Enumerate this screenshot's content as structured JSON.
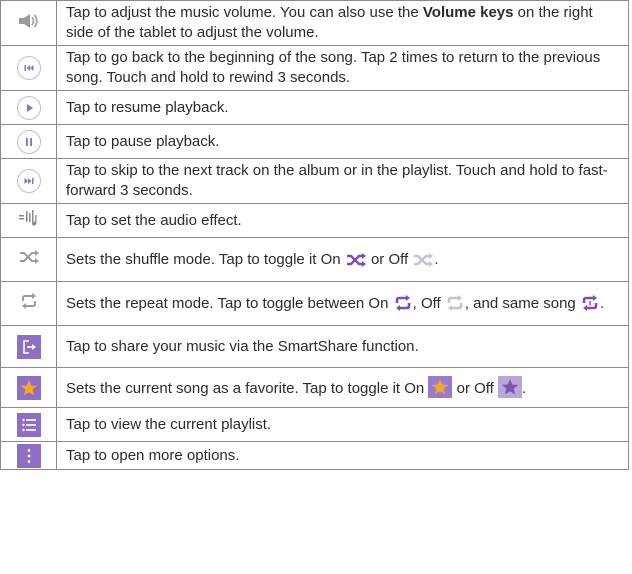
{
  "rows": [
    {
      "icon": "volume-icon",
      "text_pre": "Tap to adjust the music volume. You can also use the ",
      "text_bold": "Volume keys",
      "text_post": " on the right side of the tablet to adjust the volume."
    },
    {
      "icon": "rewind-icon",
      "text": "Tap to go back to the beginning of the song. Tap 2 times to return to the previous song. Touch and hold to rewind 3 seconds."
    },
    {
      "icon": "play-icon",
      "text": "Tap to resume playback."
    },
    {
      "icon": "pause-icon",
      "text": "Tap to pause playback."
    },
    {
      "icon": "fast-forward-icon",
      "text": "Tap to skip to the next track on the album or in the playlist. Touch and hold to fast-forward 3 seconds."
    },
    {
      "icon": "audio-effect-icon",
      "text": "Tap to set the audio effect."
    },
    {
      "icon": "shuffle-icon",
      "text_pre": "Sets the shuffle mode. Tap to toggle it On ",
      "text_mid": " or Off ",
      "text_post": "."
    },
    {
      "icon": "repeat-icon",
      "text_pre": "Sets the repeat mode. Tap to toggle between On ",
      "text_mid1": ", Off ",
      "text_mid2": ", and same song ",
      "text_post": "."
    },
    {
      "icon": "smartshare-icon",
      "text": "Tap to share your music via the SmartShare function."
    },
    {
      "icon": "favorite-star-icon",
      "text_pre": "Sets the current song as a favorite. Tap to toggle it On ",
      "text_mid": " or Off ",
      "text_post": "."
    },
    {
      "icon": "playlist-icon",
      "text": "Tap to view the current playlist."
    },
    {
      "icon": "more-options-icon",
      "text": "Tap to open more options."
    }
  ],
  "colors": {
    "accent": "#8f6fc4",
    "shuffle_on": "#7b4fb8",
    "shuffle_off": "#c9c0d6",
    "star": "#f5a623"
  }
}
